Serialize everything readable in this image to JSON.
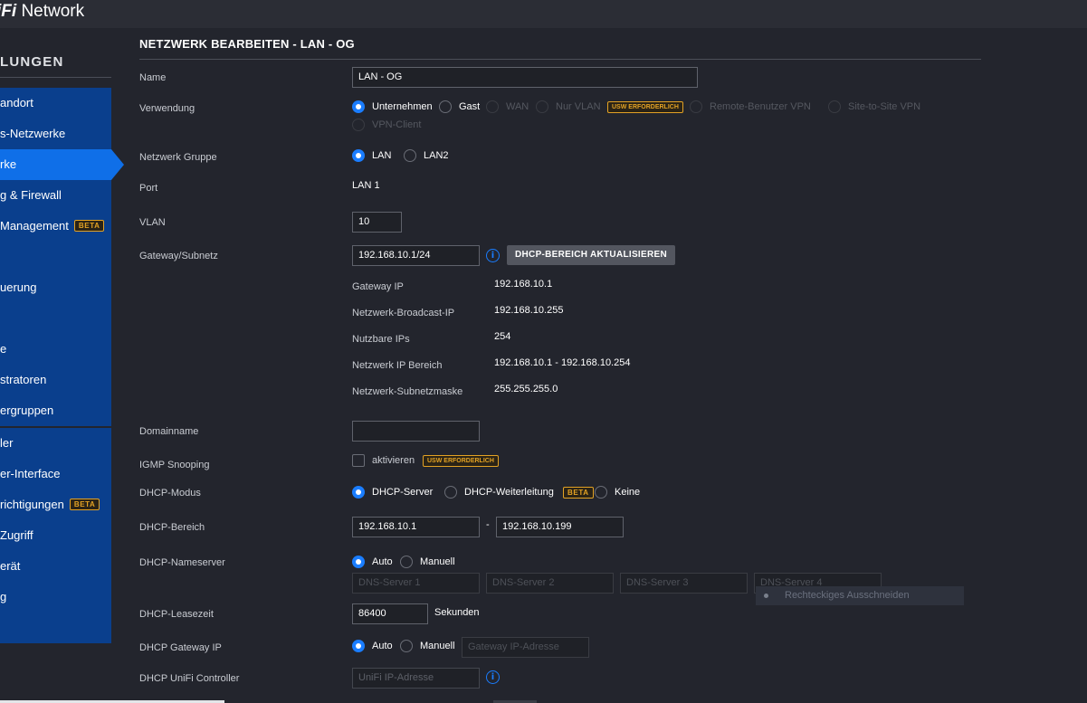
{
  "app": {
    "brand_logo": "iFi",
    "brand_name": "Network"
  },
  "sidebar": {
    "heading": "LUNGEN",
    "items": [
      {
        "label": "andort"
      },
      {
        "label": "s-Netzwerke"
      },
      {
        "label": "rke",
        "active": true
      },
      {
        "label": "g & Firewall"
      },
      {
        "label": "Management",
        "beta": "BETA"
      },
      {
        "label": ""
      },
      {
        "label": "uerung"
      },
      {
        "label": ""
      },
      {
        "label": "e"
      },
      {
        "label": "stratoren"
      },
      {
        "label": "ergruppen"
      },
      {
        "label": "ler"
      },
      {
        "label": "er-Interface"
      },
      {
        "label": "richtigungen",
        "beta": "BETA"
      },
      {
        "label": "Zugriff"
      },
      {
        "label": "erät"
      },
      {
        "label": "g"
      }
    ]
  },
  "page": {
    "title": "NETZWERK BEARBEITEN - LAN - OG"
  },
  "form": {
    "name": {
      "label": "Name",
      "value": "LAN - OG"
    },
    "purpose": {
      "label": "Verwendung",
      "options": [
        "Unternehmen",
        "Gast",
        "WAN",
        "Nur VLAN",
        "Remote-Benutzer VPN",
        "Site-to-Site VPN",
        "VPN-Client"
      ],
      "selected": "Unternehmen",
      "usw_badge": "USW ERFORDERLICH"
    },
    "network_group": {
      "label": "Netzwerk Gruppe",
      "options": [
        "LAN",
        "LAN2"
      ],
      "selected": "LAN"
    },
    "port": {
      "label": "Port",
      "value": "LAN 1"
    },
    "vlan": {
      "label": "VLAN",
      "value": "10"
    },
    "gateway_subnet": {
      "label": "Gateway/Subnetz",
      "value": "192.168.10.1/24",
      "button": "DHCP-BEREICH AKTUALISIEREN"
    },
    "subnet_info": [
      {
        "label": "Gateway IP",
        "value": "192.168.10.1"
      },
      {
        "label": "Netzwerk-Broadcast-IP",
        "value": "192.168.10.255"
      },
      {
        "label": "Nutzbare IPs",
        "value": "254"
      },
      {
        "label": "Netzwerk IP Bereich",
        "value": "192.168.10.1 - 192.168.10.254"
      },
      {
        "label": "Netzwerk-Subnetzmaske",
        "value": "255.255.255.0"
      }
    ],
    "domain": {
      "label": "Domainname",
      "value": ""
    },
    "igmp": {
      "label": "IGMP Snooping",
      "checkbox_label": "aktivieren",
      "checked": false,
      "usw_badge": "USW ERFORDERLICH"
    },
    "dhcp_mode": {
      "label": "DHCP-Modus",
      "options": [
        "DHCP-Server",
        "DHCP-Weiterleitung",
        "Keine"
      ],
      "selected": "DHCP-Server",
      "beta": "BETA"
    },
    "dhcp_range": {
      "label": "DHCP-Bereich",
      "start": "192.168.10.1",
      "separator": "-",
      "end": "192.168.10.199"
    },
    "dhcp_nameserver": {
      "label": "DHCP-Nameserver",
      "options": [
        "Auto",
        "Manuell"
      ],
      "selected": "Auto",
      "placeholders": [
        "DNS-Server 1",
        "DNS-Server 2",
        "DNS-Server 3",
        "DNS-Server 4"
      ]
    },
    "dhcp_lease": {
      "label": "DHCP-Leasezeit",
      "value": "86400",
      "unit": "Sekunden"
    },
    "dhcp_gateway": {
      "label": "DHCP Gateway IP",
      "options": [
        "Auto",
        "Manuell"
      ],
      "selected": "Auto",
      "placeholder": "Gateway IP-Adresse"
    },
    "dhcp_controller": {
      "label": "DHCP UniFi Controller",
      "placeholder": "UniFi IP-Adresse"
    }
  },
  "overlay": {
    "tooltip": "Rechteckiges Ausschneiden"
  },
  "colors": {
    "accent": "#1a7dff",
    "nav_block": "#0a3f8d",
    "nav_active": "#0f6fe8",
    "badge": "#e3a224",
    "background": "#23252d"
  }
}
